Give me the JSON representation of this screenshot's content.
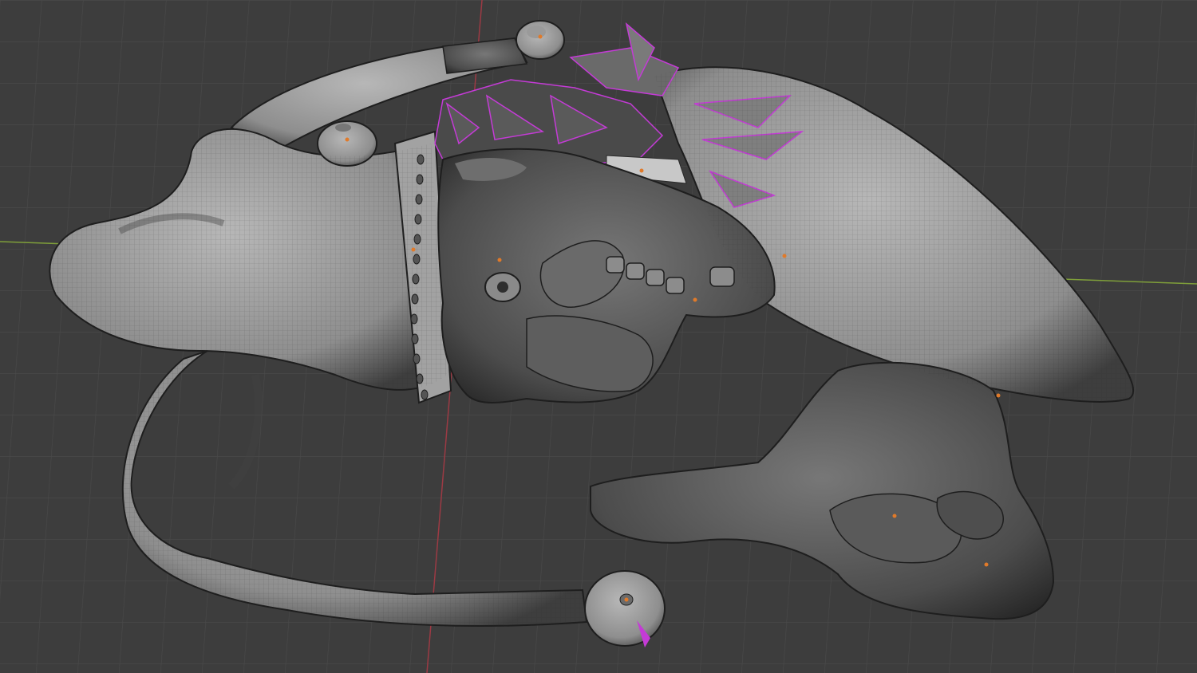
{
  "viewport": {
    "background_color": "#3d3d3d",
    "grid_color": "#4a4a4a",
    "axis_x_color": "#7f9f3a",
    "axis_y_color": "#9c3a44",
    "mesh_fill_color": "#9a9a9a",
    "mesh_shadow_color": "#4a4a4a",
    "wire_color": "#2a2a2a",
    "seam_color": "#c43bd6",
    "origin_color": "#e07a2a"
  },
  "model": {
    "parts": [
      "torso",
      "left-arm",
      "right-arm",
      "leg-bent",
      "leg-lower",
      "hand-fist",
      "head",
      "hat-brim",
      "hair",
      "ear",
      "eye",
      "teeth",
      "nose",
      "knob-top",
      "knob-small",
      "knob-bottom"
    ]
  }
}
